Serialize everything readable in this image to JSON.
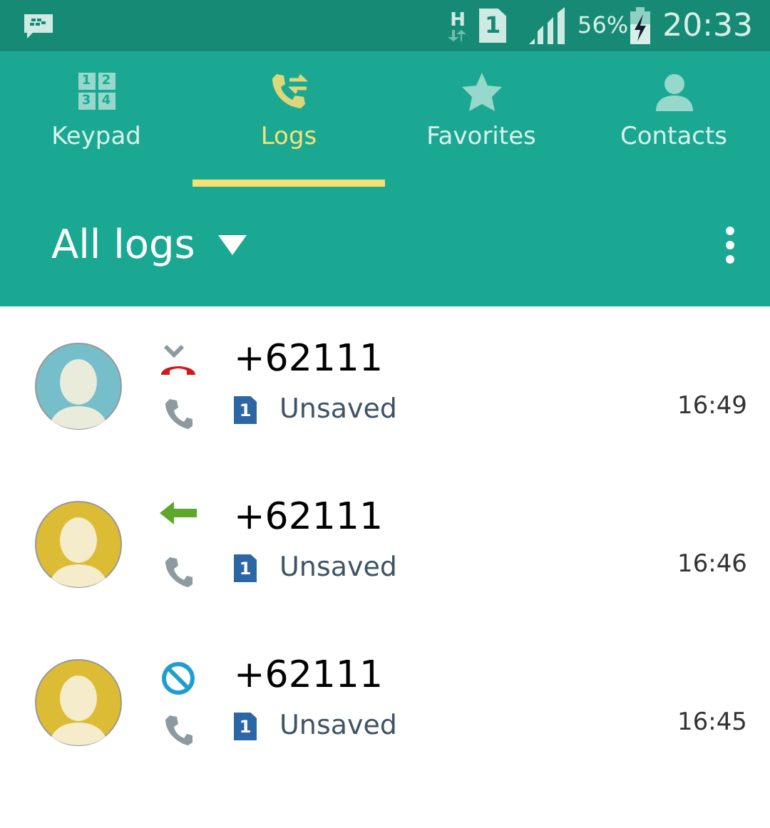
{
  "status_bar": {
    "battery_percent": "56%",
    "network": "H",
    "sim": "1",
    "time": "20:33"
  },
  "tabs": [
    {
      "label": "Keypad",
      "kind": "keypad",
      "keys": [
        "1",
        "2",
        "3",
        "4"
      ],
      "selected": false
    },
    {
      "label": "Logs",
      "kind": "logs",
      "selected": true
    },
    {
      "label": "Favorites",
      "kind": "star",
      "selected": false
    },
    {
      "label": "Contacts",
      "kind": "person",
      "selected": false
    }
  ],
  "filter": {
    "label": "All logs"
  },
  "calls": [
    {
      "number": "+62111",
      "sim": "1",
      "status": "Unsaved",
      "time": "16:49",
      "kind": "missed",
      "color": "#76bec9"
    },
    {
      "number": "+62111",
      "sim": "1",
      "status": "Unsaved",
      "time": "16:46",
      "kind": "incoming",
      "color": "#dcbc34"
    },
    {
      "number": "+62111",
      "sim": "1",
      "status": "Unsaved",
      "time": "16:45",
      "kind": "rejected",
      "color": "#dcbc34"
    }
  ]
}
